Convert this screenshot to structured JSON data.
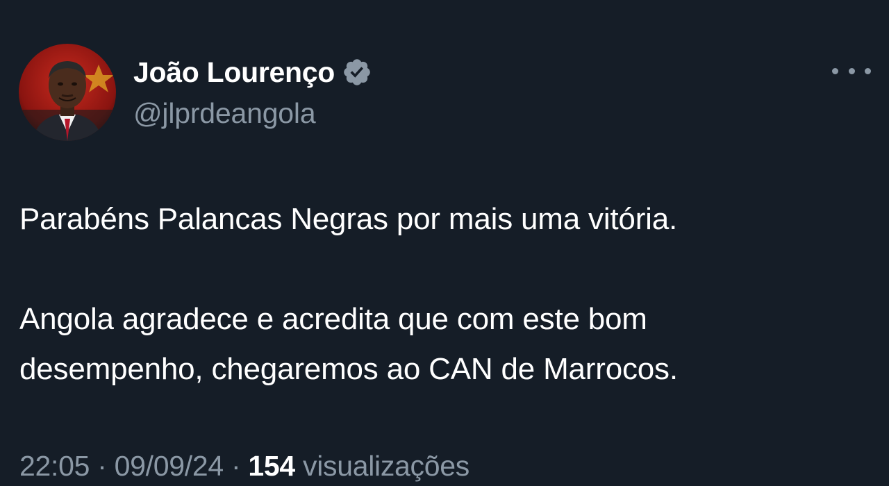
{
  "author": {
    "display_name": "João Lourenço",
    "handle": "@jlprdeangola",
    "verified_icon": "verified-badge-icon"
  },
  "menu": {
    "icon": "more-options-icon"
  },
  "tweet": {
    "text": "Parabéns Palancas Negras por mais uma vitória.\n\nAngola agradece e acredita que com este bom\ndesempenho, chegaremos ao CAN de Marrocos."
  },
  "meta": {
    "time": "22:05",
    "separator": " · ",
    "date": "09/09/24",
    "views_count": "154",
    "views_label": "visualizações"
  },
  "colors": {
    "background": "#151d27",
    "text_primary": "#ffffff",
    "text_secondary": "#8b98a5",
    "verified_badge": "#8b98a5"
  }
}
